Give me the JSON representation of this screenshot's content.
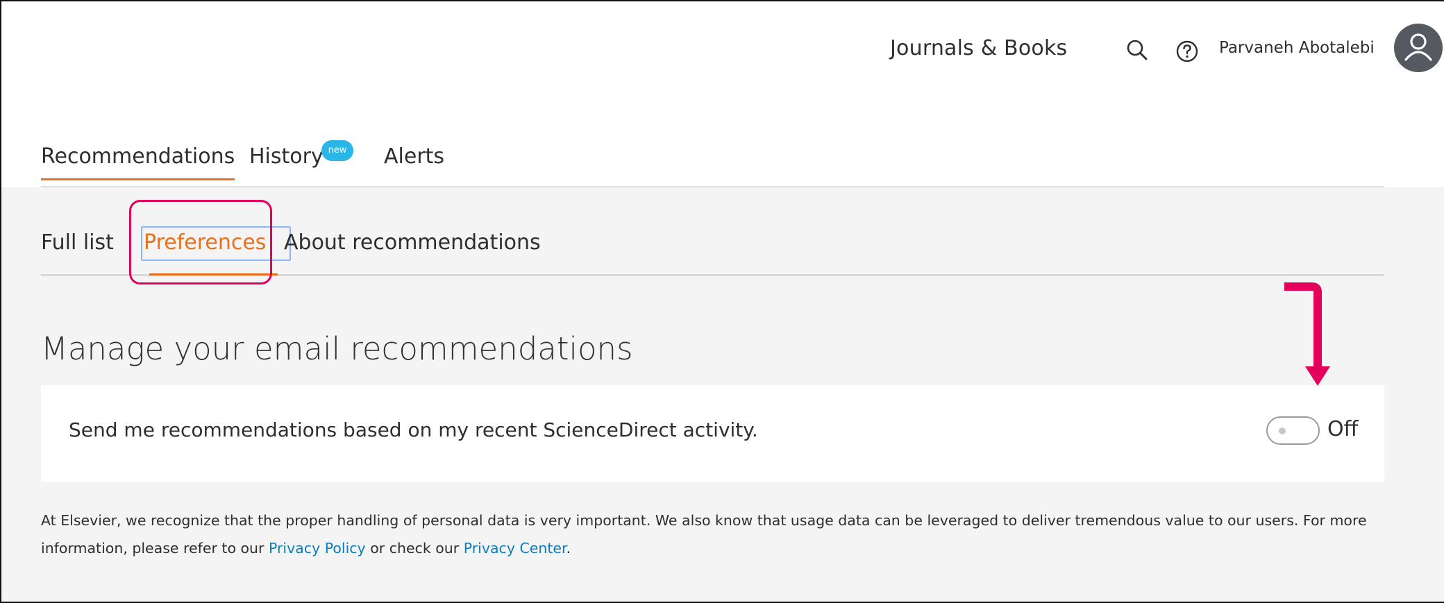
{
  "header": {
    "journals_books": "Journals & Books",
    "user_name": "Parvaneh Abotalebi"
  },
  "main_tabs": [
    {
      "label": "Recommendations"
    },
    {
      "label": "History"
    },
    {
      "label": "Alerts"
    }
  ],
  "history_badge": "new",
  "sub_tabs": [
    {
      "label": "Full list"
    },
    {
      "label": "Preferences"
    },
    {
      "label": "About recommendations"
    }
  ],
  "section": {
    "title": "Manage your email recommendations"
  },
  "preference": {
    "text": "Send me recommendations based on my recent ScienceDirect activity.",
    "toggle_state": "Off"
  },
  "footer": {
    "text_before": "At Elsevier, we recognize that the proper handling of personal data is very important. We also know that usage data can be leveraged to deliver tremendous value to our users. For more information, please refer to our ",
    "privacy_policy": "Privacy Policy",
    "text_middle": " or check our ",
    "privacy_center": "Privacy Center",
    "text_after": "."
  },
  "colors": {
    "accent": "#e9711c",
    "annotation": "#e5005b",
    "link": "#0c7dbb",
    "badge": "#29b6e8"
  }
}
